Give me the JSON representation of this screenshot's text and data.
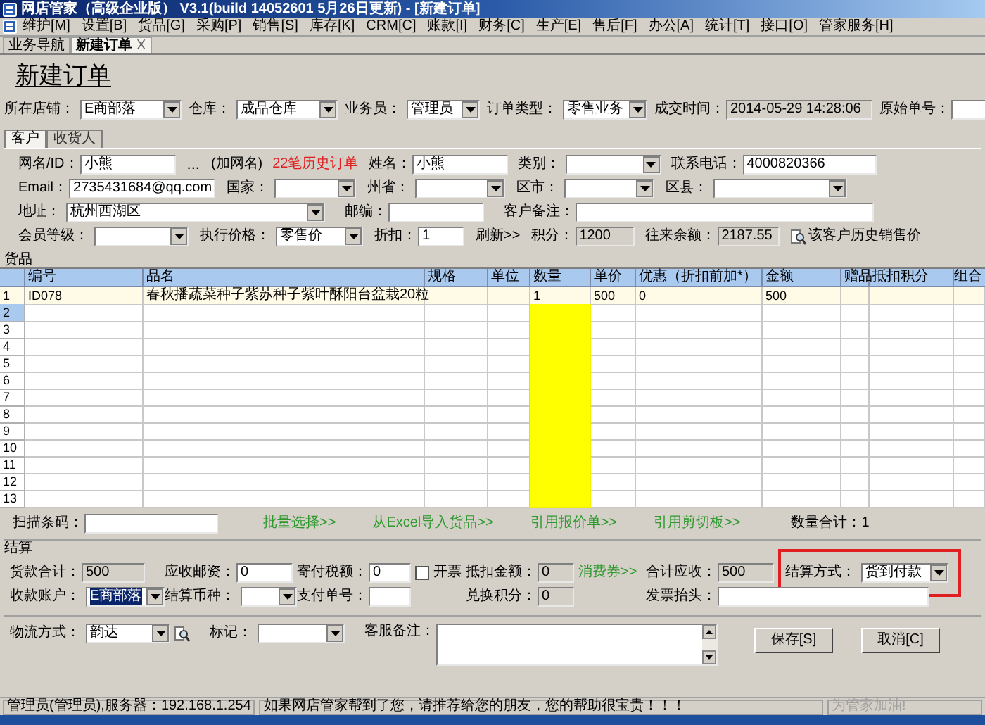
{
  "window": {
    "title": "网店管家（高级企业版） V3.1(build 14052601 5月26日更新) - [新建订单]"
  },
  "menu": [
    "维护[M]",
    "设置[B]",
    "货品[G]",
    "采购[P]",
    "销售[S]",
    "库存[K]",
    "CRM[C]",
    "账款[I]",
    "财务[C]",
    "生产[E]",
    "售后[F]",
    "办公[A]",
    "统计[T]",
    "接口[O]",
    "管家服务[H]"
  ],
  "tabs": [
    {
      "label": "业务导航",
      "selected": false
    },
    {
      "label": "新建订单",
      "selected": true,
      "close": "X"
    }
  ],
  "heading": "新建订单",
  "order_fields": [
    {
      "kind": "combo",
      "label": "所在店铺：",
      "value": "E商部落"
    },
    {
      "kind": "combo",
      "label": "仓库：",
      "value": "成品仓库"
    },
    {
      "kind": "combo",
      "label": "业务员：",
      "value": "管理员"
    },
    {
      "kind": "combo",
      "label": "订单类型：",
      "value": "零售业务"
    },
    {
      "kind": "readonly",
      "label": "成交时间：",
      "value": "2014-05-29 14:28:06"
    },
    {
      "kind": "text",
      "label": "原始单号："
    }
  ],
  "customer_tabs": [
    {
      "label": "客户",
      "selected": true
    },
    {
      "label": "收货人",
      "selected": false
    }
  ],
  "customer_rows": [
    [
      {
        "kind": "text",
        "label": "网名/ID：",
        "value": "小熊"
      },
      {
        "kind": "ellipsis",
        "text": "..."
      },
      {
        "kind": "note",
        "text": "(加网名)"
      },
      {
        "kind": "alert",
        "text": "22笔历史订单"
      },
      {
        "kind": "text",
        "label": "姓名：",
        "value": "小熊"
      },
      {
        "kind": "combo",
        "label": "类别："
      },
      {
        "kind": "text",
        "label": "联系电话：",
        "value": "4000820366"
      }
    ],
    [
      {
        "kind": "text",
        "label": "Email：",
        "value": "2735431684@qq.com"
      },
      {
        "kind": "combo",
        "label": "国家："
      },
      {
        "kind": "combo",
        "label": "州省："
      },
      {
        "kind": "combo",
        "label": "区市："
      },
      {
        "kind": "combo",
        "label": "区县："
      }
    ],
    [
      {
        "kind": "combo",
        "label": "地址：",
        "value": "杭州西湖区"
      },
      {
        "kind": "text",
        "label": "邮编："
      },
      {
        "kind": "text",
        "label": "客户备注："
      }
    ],
    [
      {
        "kind": "combo",
        "label": "会员等级："
      },
      {
        "kind": "combo",
        "label": "执行价格：",
        "value": "零售价"
      },
      {
        "kind": "text",
        "label": "折扣：",
        "value": "1"
      },
      {
        "kind": "plain_link",
        "text": "刷新>>"
      },
      {
        "kind": "readonly",
        "label": "积分：",
        "value": "1200"
      },
      {
        "kind": "readonly",
        "label": "往来余额：",
        "value": "2187.55"
      },
      {
        "kind": "icon_link",
        "text": "该客户历史销售价"
      }
    ]
  ],
  "goods": {
    "title": "货品",
    "columns": [
      "",
      "编号",
      "品名",
      "规格",
      "单位",
      "数量",
      "单价",
      "优惠（折扣前加*）",
      "金额",
      "赠品",
      "抵扣积分",
      "组合"
    ],
    "rows": [
      {
        "selected": false,
        "cells": [
          "1",
          "ID078",
          "春秋播蔬菜种子紫苏种子紫叶酥阳台盆栽20粒",
          "",
          "",
          "1",
          "500",
          "0",
          "500",
          "",
          "",
          ""
        ]
      },
      {
        "selected": true,
        "cells": [
          "2"
        ]
      },
      {
        "selected": false,
        "cells": [
          "3"
        ]
      },
      {
        "selected": false,
        "cells": [
          "4"
        ]
      },
      {
        "selected": false,
        "cells": [
          "5"
        ]
      },
      {
        "selected": false,
        "cells": [
          "6"
        ]
      },
      {
        "selected": false,
        "cells": [
          "7"
        ]
      },
      {
        "selected": false,
        "cells": [
          "8"
        ]
      },
      {
        "selected": false,
        "cells": [
          "9"
        ]
      },
      {
        "selected": false,
        "cells": [
          "10"
        ]
      },
      {
        "selected": false,
        "cells": [
          "11"
        ]
      },
      {
        "selected": false,
        "cells": [
          "12"
        ]
      },
      {
        "selected": false,
        "cells": [
          "13"
        ]
      }
    ]
  },
  "scan": {
    "label": "扫描条码：",
    "links": [
      "批量选择>>",
      "从Excel导入货品>>",
      "引用报价单>>",
      "引用剪切板>>"
    ],
    "total": "数量合计：1"
  },
  "settlement": {
    "title": "结算",
    "rows": [
      [
        {
          "kind": "readonly",
          "label": "货款合计：",
          "value": "500"
        },
        {
          "kind": "text",
          "label": "应收邮资：",
          "value": "0"
        },
        {
          "kind": "text",
          "label": "寄付税额：",
          "value": "0"
        },
        {
          "kind": "checkbox",
          "label": "开票",
          "checked": false
        },
        {
          "kind": "readonly",
          "label": "抵扣金额：",
          "value": "0"
        },
        {
          "kind": "link",
          "text": "消费券>>"
        },
        {
          "kind": "readonly",
          "label": "合计应收：",
          "value": "500"
        },
        {
          "kind": "combo",
          "label": "结算方式：",
          "value": "货到付款",
          "highlighted": true
        }
      ],
      [
        {
          "kind": "combo",
          "label": "收款账户：",
          "value": "E商部落",
          "selected": true
        },
        {
          "kind": "combo",
          "label": "结算币种："
        },
        {
          "kind": "text",
          "label": "支付单号："
        },
        "",
        {
          "kind": "readonly",
          "label": "兑换积分：",
          "value": "0"
        },
        "",
        {
          "kind": "text",
          "label": "发票抬头："
        }
      ]
    ]
  },
  "bottom_row": [
    {
      "kind": "combo_lookup",
      "label": "物流方式：",
      "value": "韵达"
    },
    {
      "kind": "combo",
      "label": "标记："
    },
    {
      "kind": "memo",
      "label": "客服备注："
    }
  ],
  "buttons": [
    "保存[S]",
    "取消[C]"
  ],
  "status_bar": [
    "管理员(管理员),服务器：192.168.1.254",
    "如果网店管家帮到了您，请推荐给您的朋友，您的帮助很宝贵！！！",
    "为管家加油!"
  ]
}
